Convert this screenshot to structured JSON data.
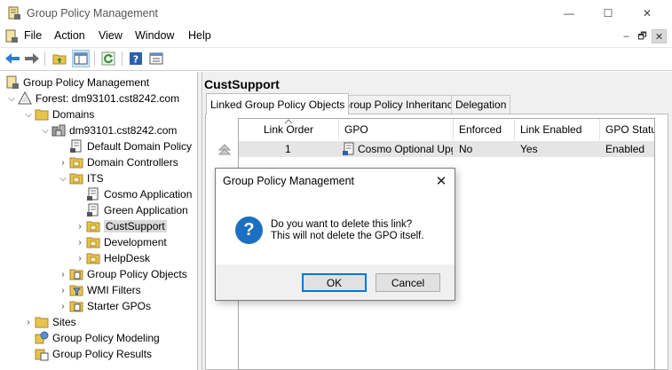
{
  "window": {
    "title": "Group Policy Management",
    "min_glyph": "—",
    "max_glyph": "☐",
    "close_glyph": "✕"
  },
  "menu": {
    "items": [
      "File",
      "Action",
      "View",
      "Window",
      "Help"
    ],
    "mdi": {
      "min": "–",
      "restore": "🗗",
      "close": "✕"
    }
  },
  "toolbar": {
    "buttons": [
      "back-arrow-icon",
      "forward-arrow-icon",
      "up-folder-icon",
      "show-hide-tree-icon",
      "refresh-icon",
      "help-icon",
      "properties-icon"
    ]
  },
  "tree": {
    "root": "Group Policy Management",
    "forest": "Forest: dm93101.cst8242.com",
    "domains": "Domains",
    "domain": "dm93101.cst8242.com",
    "default_policy": "Default Domain Policy",
    "domain_controllers": "Domain Controllers",
    "its": "ITS",
    "cosmo": "Cosmo Application",
    "green": "Green Application",
    "custsupport": "CustSupport",
    "development": "Development",
    "helpdesk": "HelpDesk",
    "gpo": "Group Policy Objects",
    "wmi": "WMI Filters",
    "starter": "Starter GPOs",
    "sites": "Sites",
    "modeling": "Group Policy Modeling",
    "results": "Group Policy Results"
  },
  "content": {
    "title": "CustSupport",
    "tabs": [
      "Linked Group Policy Objects",
      "Group Policy Inheritance",
      "Delegation"
    ],
    "columns": [
      "Link Order",
      "GPO",
      "Enforced",
      "Link Enabled",
      "GPO Status"
    ],
    "rows": [
      {
        "order": "1",
        "gpo": "Cosmo Optional Upg...",
        "enforced": "No",
        "link_enabled": "Yes",
        "status": "Enabled"
      }
    ]
  },
  "dialog": {
    "title": "Group Policy Management",
    "icon": "?",
    "line1": "Do you want to delete this link?",
    "line2": "This will not delete the GPO itself.",
    "ok": "OK",
    "cancel": "Cancel"
  },
  "colors": {
    "accent": "#0078d7",
    "question_icon": "#1c6fc1",
    "selected_row": "#e5e5e5"
  }
}
